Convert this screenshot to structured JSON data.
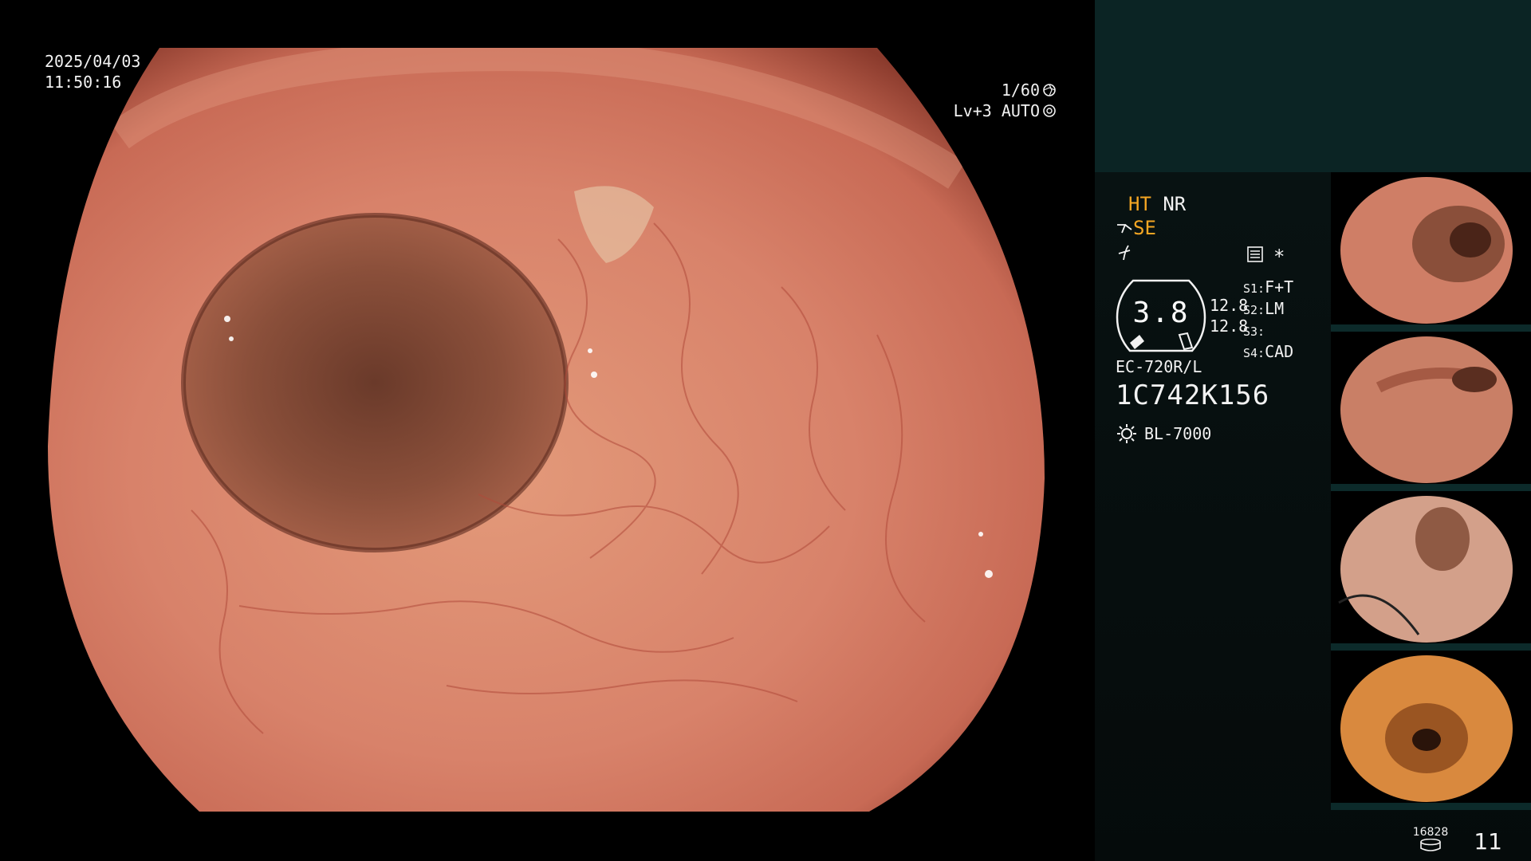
{
  "osd": {
    "date": "2025/04/03",
    "time": "11:50:16",
    "shutter": "1/60",
    "level": "Lv+3 AUTO"
  },
  "panel": {
    "mode_top_a": "HT",
    "mode_top_b": "NR",
    "mode_se": "SE",
    "gauge_value": "3.8",
    "num_1": "12.8",
    "num_2": "12.8",
    "slots": [
      {
        "key": "S1:",
        "value": "F+T"
      },
      {
        "key": "S2:",
        "value": "LM"
      },
      {
        "key": "S3:",
        "value": ""
      },
      {
        "key": "S4:",
        "value": "CAD"
      }
    ],
    "scope_model": "EC-720R/L",
    "scope_serial": "1C742K156",
    "light_source": "BL-7000",
    "store_count": "16828",
    "image_index": "11"
  },
  "colors": {
    "accent": "#f5a623",
    "panel_top": "#0b2424",
    "panel_bg": "#050b0b"
  },
  "icons": [
    "shutter-icon",
    "auto-iris-icon",
    "scope-icon",
    "freeze-icon",
    "settings-icon",
    "asterisk-icon",
    "light-icon",
    "storage-icon"
  ]
}
